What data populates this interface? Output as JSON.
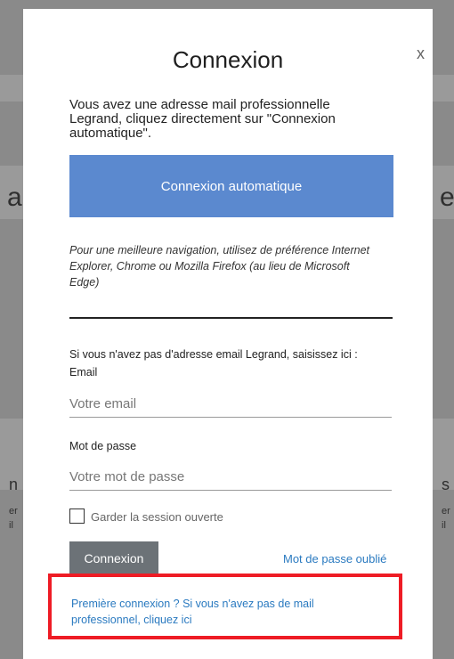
{
  "modal": {
    "title": "Connexion",
    "close_label": "x",
    "intro_text": "Vous avez une adresse mail professionnelle Legrand, cliquez directement sur \"Connexion automatique\".",
    "auto_login_button": "Connexion automatique",
    "browser_note": "Pour une meilleure navigation, utilisez de préférence Internet Explorer, Chrome ou Mozilla Firefox (au lieu de Microsoft Edge)",
    "no_email_text": "Si vous n'avez pas d'adresse email Legrand, saisissez ici :",
    "email_label": "Email",
    "email_placeholder": "Votre email",
    "email_value": "",
    "password_label": "Mot de passe",
    "password_placeholder": "Votre mot de passe",
    "password_value": "",
    "keep_session_label": "Garder la session ouverte",
    "keep_session_checked": false,
    "login_button": "Connexion",
    "forgot_password_link": "Mot de passe oublié",
    "first_login_link": "Première connexion ? Si vous n'avez pas de mail professionnel, cliquez ici"
  },
  "background": {
    "fragments": [
      "a",
      "e",
      "n",
      "s",
      "er",
      "il",
      "er",
      "il"
    ]
  },
  "colors": {
    "backdrop": "#8a8a8a",
    "primary_button": "#5b89cf",
    "secondary_button": "#6c7277",
    "link": "#2a7ac0",
    "highlight": "#ee1c25"
  }
}
